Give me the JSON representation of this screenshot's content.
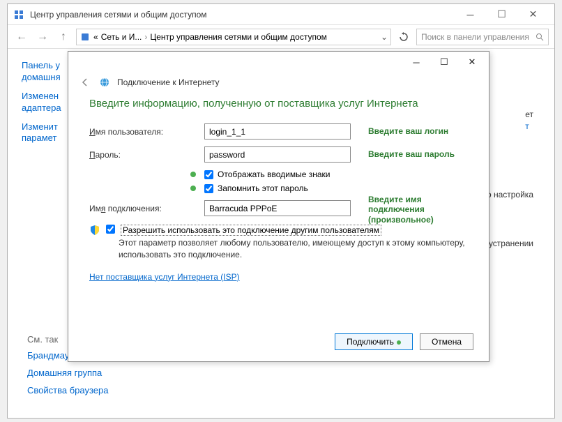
{
  "parent": {
    "title": "Центр управления сетями и общим доступом",
    "breadcrumb": {
      "part1": "Сеть и И...",
      "part2": "Центр управления сетями и общим доступом"
    },
    "search_placeholder": "Поиск в панели управления",
    "sidebar": {
      "links": [
        "Панель у\nдомашня",
        "Изменен\nадаптера",
        "Изменит\nпарамет"
      ],
      "footer_heading": "См. так",
      "footer_links": [
        "Брандмауэр Windows",
        "Домашняя группа",
        "Свойства браузера"
      ]
    },
    "right_hints": [
      {
        "text": "ет",
        "link": "т"
      },
      {
        "text": "ибо настройка"
      },
      {
        "text": "и устранении"
      }
    ]
  },
  "dialog": {
    "title": "Подключение к Интернету",
    "instruction": "Введите информацию, полученную от поставщика услуг Интернета",
    "username_label": "Имя пользователя:",
    "username_u": "И",
    "username_value": "login_1_1",
    "username_hint": "Введите ваш логин",
    "password_label": "Пароль:",
    "password_u": "П",
    "password_value": "password",
    "password_hint": "Введите ваш пароль",
    "show_chars_label": "Отображать вводимые знаки",
    "show_chars_u": "О",
    "remember_label": "Запомнить этот пароль",
    "remember_u": "З",
    "conn_name_label": "Имя подключения:",
    "conn_name_u": "я",
    "conn_name_value": "Barracuda PPPoE",
    "conn_name_hint": "Введите имя подключения (произвольное)",
    "allow_label": "Разрешить использовать это подключение другим пользователям",
    "allow_u": "Р",
    "allow_desc": "Этот параметр позволяет любому пользователю, имеющему доступ к этому компьютеру, использовать это подключение.",
    "isp_link": "Нет поставщика услуг Интернета (ISP)",
    "connect_btn": "Подключить",
    "cancel_btn": "Отмена"
  }
}
